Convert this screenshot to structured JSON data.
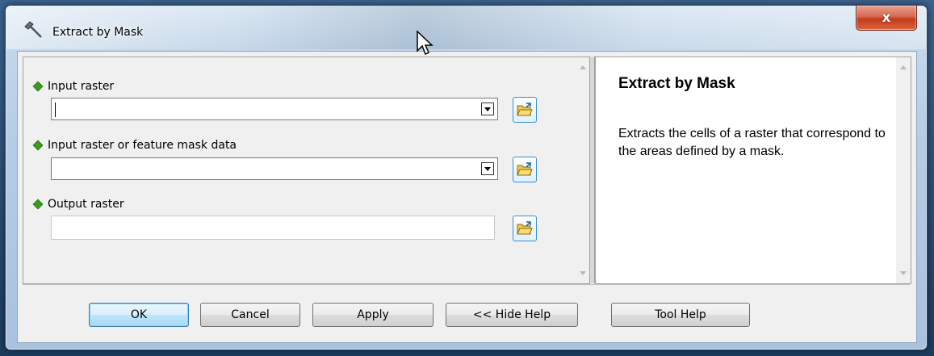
{
  "window": {
    "title": "Extract by Mask",
    "close_label": "x"
  },
  "params": [
    {
      "label": "Input raster",
      "value": ""
    },
    {
      "label": "Input raster or feature mask data",
      "value": ""
    },
    {
      "label": "Output raster",
      "value": ""
    }
  ],
  "help": {
    "title": "Extract by Mask",
    "text": "Extracts the cells of a raster that correspond to the areas defined by a mask."
  },
  "buttons": {
    "ok": "OK",
    "cancel": "Cancel",
    "apply": "Apply",
    "hide_help": "<< Hide Help",
    "tool_help": "Tool Help"
  },
  "icons": {
    "title": "hammer-icon",
    "browse": "folder-open-icon",
    "required": "green-diamond-icon"
  },
  "colors": {
    "required_marker": "#3a9b1e",
    "close_button": "#c4391c",
    "default_button_border": "#3c7fb1"
  }
}
